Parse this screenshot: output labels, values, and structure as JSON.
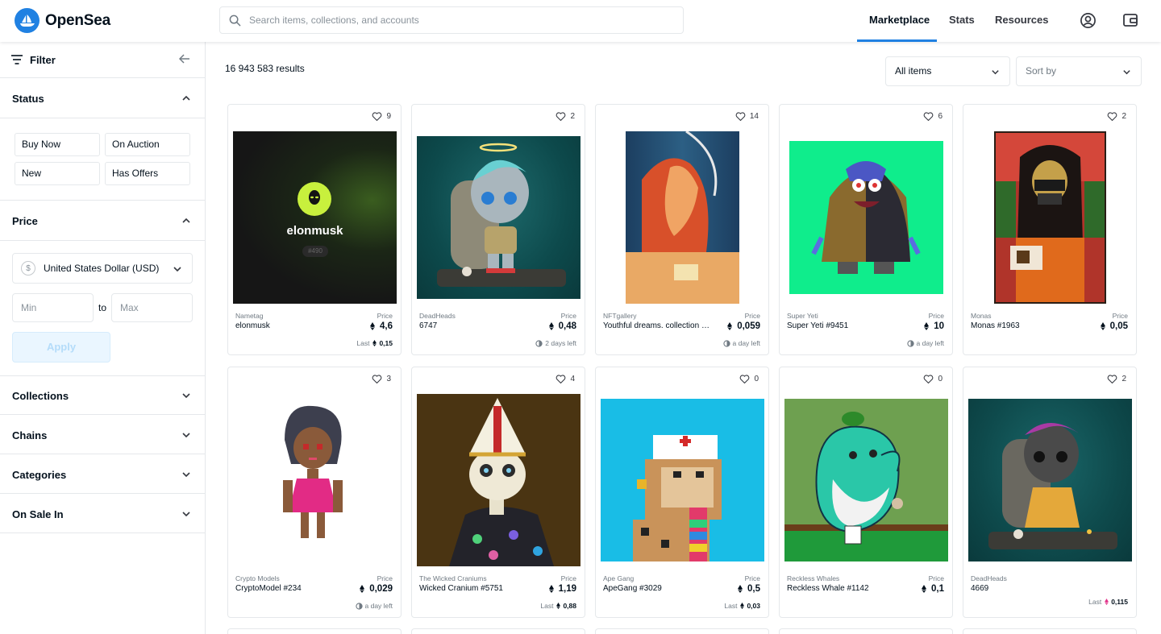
{
  "header": {
    "logo_text": "OpenSea",
    "search_placeholder": "Search items, collections, and accounts",
    "nav": [
      "Marketplace",
      "Stats",
      "Resources"
    ]
  },
  "sidebar": {
    "filter_label": "Filter",
    "status_title": "Status",
    "status_buttons": [
      "Buy Now",
      "On Auction",
      "New",
      "Has Offers"
    ],
    "price_title": "Price",
    "currency_symbol": "$",
    "currency": "United States Dollar (USD)",
    "min_placeholder": "Min",
    "to_label": "to",
    "max_placeholder": "Max",
    "apply_label": "Apply",
    "sections": [
      "Collections",
      "Chains",
      "Categories",
      "On Sale In"
    ]
  },
  "main": {
    "results": "16 943 583 results",
    "item_filter": "All items",
    "sort": "Sort by"
  },
  "cards": [
    {
      "likes": "9",
      "collection": "Nametag",
      "name": "elonmusk",
      "price_label": "Price",
      "price": "4,6",
      "last_label": "Last",
      "last": "0,15",
      "art_title": "elonmusk",
      "art_sub": "#490"
    },
    {
      "likes": "2",
      "collection": "DeadHeads",
      "name": "6747",
      "price_label": "Price",
      "price": "0,48",
      "time_left": "2 days left"
    },
    {
      "likes": "14",
      "collection": "NFTgallery",
      "name": "Youthful dreams. collection #...",
      "price_label": "Price",
      "price": "0,059",
      "time_left": "a day left"
    },
    {
      "likes": "6",
      "collection": "Super Yeti",
      "name": "Super Yeti #9451",
      "price_label": "Price",
      "price": "10",
      "time_left": "a day left"
    },
    {
      "likes": "2",
      "collection": "Monas",
      "name": "Monas #1963",
      "price_label": "Price",
      "price": "0,05"
    },
    {
      "likes": "3",
      "collection": "Crypto Models",
      "name": "CryptoModel #234",
      "price_label": "Price",
      "price": "0,029",
      "time_left": "a day left"
    },
    {
      "likes": "4",
      "collection": "The Wicked Craniums",
      "name": "Wicked Cranium #5751",
      "price_label": "Price",
      "price": "1,19",
      "last_label": "Last",
      "last": "0,88"
    },
    {
      "likes": "0",
      "collection": "Ape Gang",
      "name": "ApeGang #3029",
      "price_label": "Price",
      "price": "0,5",
      "last_label": "Last",
      "last": "0,03"
    },
    {
      "likes": "0",
      "collection": "Reckless Whales",
      "name": "Reckless Whale #1142",
      "price_label": "Price",
      "price": "0,1"
    },
    {
      "likes": "2",
      "collection": "DeadHeads",
      "name": "4669",
      "last_label": "Last",
      "last": "0,115"
    }
  ],
  "colors": {
    "accent": "#2081e2",
    "text": "#04111d",
    "muted": "#707a83",
    "border": "#e5e8eb"
  }
}
